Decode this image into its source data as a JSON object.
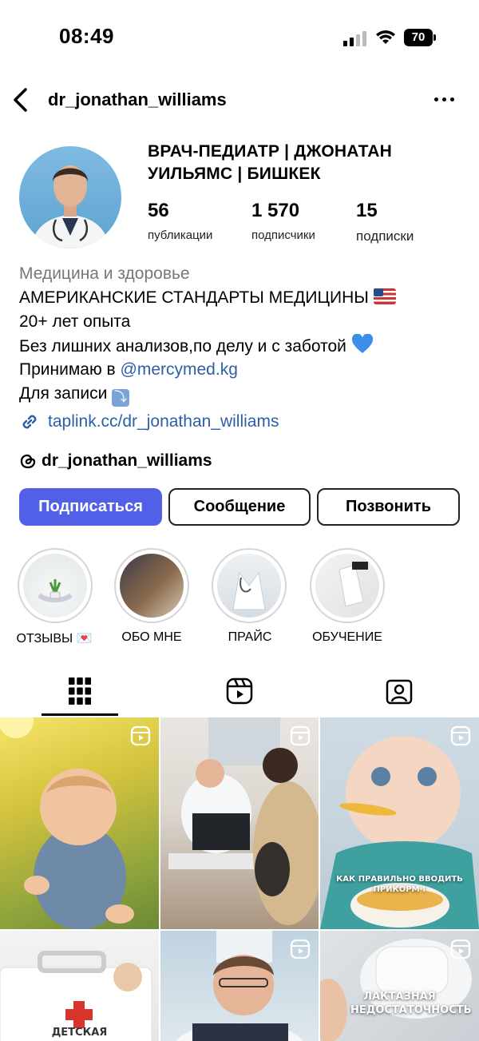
{
  "status_bar": {
    "time": "08:49",
    "battery": "70"
  },
  "header": {
    "username": "dr_jonathan_williams"
  },
  "profile": {
    "display_name": "ВРАЧ-ПЕДИАТР | ДЖОНАТАН УИЛЬЯМС | БИШКЕК",
    "stats": [
      {
        "value": "56",
        "label": "публикации"
      },
      {
        "value": "1 570",
        "label": "подписчики"
      },
      {
        "value": "15",
        "label": "подписки"
      }
    ]
  },
  "bio": {
    "category": "Медицина и здоровье",
    "line1": "АМЕРИКАНСКИЕ СТАНДАРТЫ МЕДИЦИНЫ",
    "line2": "20+ лет опыта",
    "line3": "Без лишних анализов,по делу и  с заботой",
    "line4_prefix": "Принимаю в ",
    "line4_mention": "@mercymed.kg",
    "line5": "Для записи",
    "link": "taplink.cc/dr_jonathan_williams",
    "threads": "dr_jonathan_williams"
  },
  "buttons": {
    "follow": "Подписаться",
    "message": "Сообщение",
    "call": "Позвонить"
  },
  "highlights": [
    {
      "label": "ОТЗЫВЫ 💌"
    },
    {
      "label": "ОБО МНЕ"
    },
    {
      "label": "ПРАЙС"
    },
    {
      "label": "ОБУЧЕНИЕ"
    }
  ],
  "posts": [
    {
      "caption": ""
    },
    {
      "caption": ""
    },
    {
      "caption": "КАК ПРАВИЛЬНО ВВОДИТЬ ПРИКОРМ !"
    },
    {
      "caption": "ДЕТСКАЯ"
    },
    {
      "caption": ""
    },
    {
      "caption": "ЛАКТАЗНАЯ НЕДОСТАТОЧНОСТЬ"
    }
  ],
  "icons": {
    "back": "chevron-left-icon",
    "more": "more-icon",
    "link": "link-icon",
    "threads": "threads-icon",
    "grid": "grid-icon",
    "reels": "reels-icon",
    "tagged": "tagged-icon"
  },
  "colors": {
    "primary_button": "#5260e8",
    "link": "#2d5fa8",
    "category": "#777777"
  }
}
